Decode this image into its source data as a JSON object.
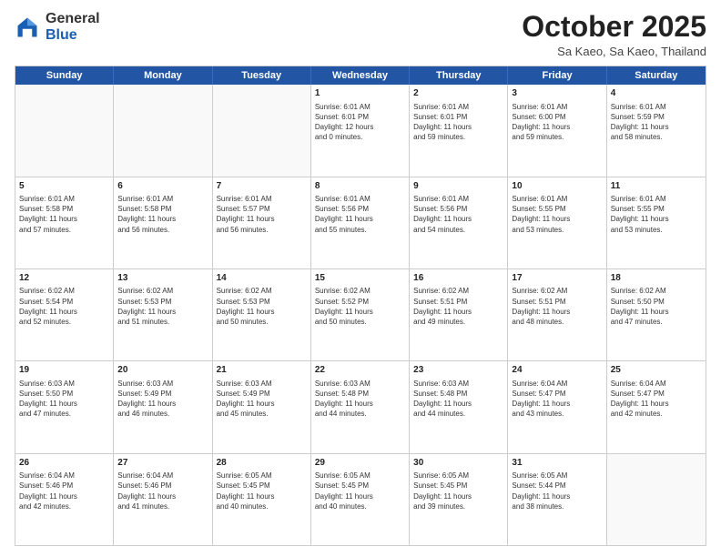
{
  "header": {
    "logo_general": "General",
    "logo_blue": "Blue",
    "month_title": "October 2025",
    "location": "Sa Kaeo, Sa Kaeo, Thailand"
  },
  "calendar": {
    "days_of_week": [
      "Sunday",
      "Monday",
      "Tuesday",
      "Wednesday",
      "Thursday",
      "Friday",
      "Saturday"
    ],
    "rows": [
      [
        {
          "day": "",
          "info": ""
        },
        {
          "day": "",
          "info": ""
        },
        {
          "day": "",
          "info": ""
        },
        {
          "day": "1",
          "info": "Sunrise: 6:01 AM\nSunset: 6:01 PM\nDaylight: 12 hours\nand 0 minutes."
        },
        {
          "day": "2",
          "info": "Sunrise: 6:01 AM\nSunset: 6:01 PM\nDaylight: 11 hours\nand 59 minutes."
        },
        {
          "day": "3",
          "info": "Sunrise: 6:01 AM\nSunset: 6:00 PM\nDaylight: 11 hours\nand 59 minutes."
        },
        {
          "day": "4",
          "info": "Sunrise: 6:01 AM\nSunset: 5:59 PM\nDaylight: 11 hours\nand 58 minutes."
        }
      ],
      [
        {
          "day": "5",
          "info": "Sunrise: 6:01 AM\nSunset: 5:58 PM\nDaylight: 11 hours\nand 57 minutes."
        },
        {
          "day": "6",
          "info": "Sunrise: 6:01 AM\nSunset: 5:58 PM\nDaylight: 11 hours\nand 56 minutes."
        },
        {
          "day": "7",
          "info": "Sunrise: 6:01 AM\nSunset: 5:57 PM\nDaylight: 11 hours\nand 56 minutes."
        },
        {
          "day": "8",
          "info": "Sunrise: 6:01 AM\nSunset: 5:56 PM\nDaylight: 11 hours\nand 55 minutes."
        },
        {
          "day": "9",
          "info": "Sunrise: 6:01 AM\nSunset: 5:56 PM\nDaylight: 11 hours\nand 54 minutes."
        },
        {
          "day": "10",
          "info": "Sunrise: 6:01 AM\nSunset: 5:55 PM\nDaylight: 11 hours\nand 53 minutes."
        },
        {
          "day": "11",
          "info": "Sunrise: 6:01 AM\nSunset: 5:55 PM\nDaylight: 11 hours\nand 53 minutes."
        }
      ],
      [
        {
          "day": "12",
          "info": "Sunrise: 6:02 AM\nSunset: 5:54 PM\nDaylight: 11 hours\nand 52 minutes."
        },
        {
          "day": "13",
          "info": "Sunrise: 6:02 AM\nSunset: 5:53 PM\nDaylight: 11 hours\nand 51 minutes."
        },
        {
          "day": "14",
          "info": "Sunrise: 6:02 AM\nSunset: 5:53 PM\nDaylight: 11 hours\nand 50 minutes."
        },
        {
          "day": "15",
          "info": "Sunrise: 6:02 AM\nSunset: 5:52 PM\nDaylight: 11 hours\nand 50 minutes."
        },
        {
          "day": "16",
          "info": "Sunrise: 6:02 AM\nSunset: 5:51 PM\nDaylight: 11 hours\nand 49 minutes."
        },
        {
          "day": "17",
          "info": "Sunrise: 6:02 AM\nSunset: 5:51 PM\nDaylight: 11 hours\nand 48 minutes."
        },
        {
          "day": "18",
          "info": "Sunrise: 6:02 AM\nSunset: 5:50 PM\nDaylight: 11 hours\nand 47 minutes."
        }
      ],
      [
        {
          "day": "19",
          "info": "Sunrise: 6:03 AM\nSunset: 5:50 PM\nDaylight: 11 hours\nand 47 minutes."
        },
        {
          "day": "20",
          "info": "Sunrise: 6:03 AM\nSunset: 5:49 PM\nDaylight: 11 hours\nand 46 minutes."
        },
        {
          "day": "21",
          "info": "Sunrise: 6:03 AM\nSunset: 5:49 PM\nDaylight: 11 hours\nand 45 minutes."
        },
        {
          "day": "22",
          "info": "Sunrise: 6:03 AM\nSunset: 5:48 PM\nDaylight: 11 hours\nand 44 minutes."
        },
        {
          "day": "23",
          "info": "Sunrise: 6:03 AM\nSunset: 5:48 PM\nDaylight: 11 hours\nand 44 minutes."
        },
        {
          "day": "24",
          "info": "Sunrise: 6:04 AM\nSunset: 5:47 PM\nDaylight: 11 hours\nand 43 minutes."
        },
        {
          "day": "25",
          "info": "Sunrise: 6:04 AM\nSunset: 5:47 PM\nDaylight: 11 hours\nand 42 minutes."
        }
      ],
      [
        {
          "day": "26",
          "info": "Sunrise: 6:04 AM\nSunset: 5:46 PM\nDaylight: 11 hours\nand 42 minutes."
        },
        {
          "day": "27",
          "info": "Sunrise: 6:04 AM\nSunset: 5:46 PM\nDaylight: 11 hours\nand 41 minutes."
        },
        {
          "day": "28",
          "info": "Sunrise: 6:05 AM\nSunset: 5:45 PM\nDaylight: 11 hours\nand 40 minutes."
        },
        {
          "day": "29",
          "info": "Sunrise: 6:05 AM\nSunset: 5:45 PM\nDaylight: 11 hours\nand 40 minutes."
        },
        {
          "day": "30",
          "info": "Sunrise: 6:05 AM\nSunset: 5:45 PM\nDaylight: 11 hours\nand 39 minutes."
        },
        {
          "day": "31",
          "info": "Sunrise: 6:05 AM\nSunset: 5:44 PM\nDaylight: 11 hours\nand 38 minutes."
        },
        {
          "day": "",
          "info": ""
        }
      ]
    ]
  }
}
